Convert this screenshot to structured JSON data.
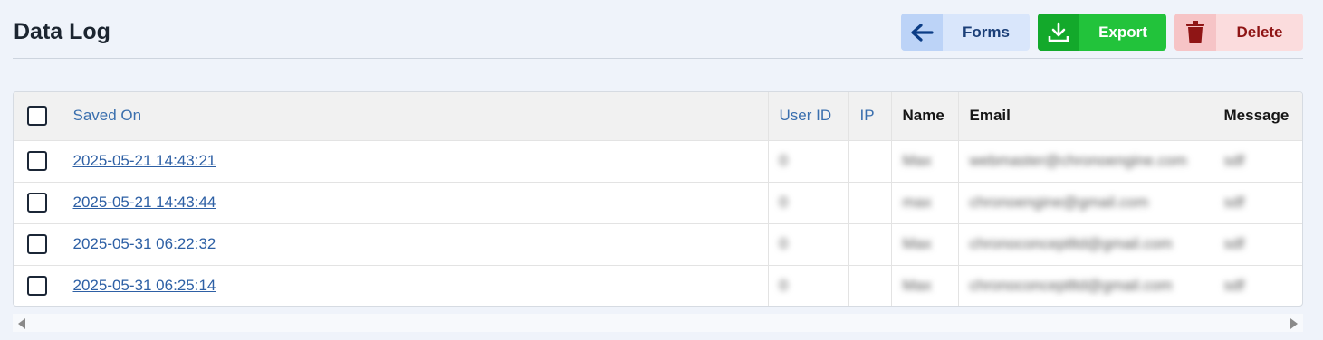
{
  "page": {
    "title": "Data Log"
  },
  "toolbar": {
    "forms_label": "Forms",
    "export_label": "Export",
    "delete_label": "Delete"
  },
  "table": {
    "columns": [
      "Saved On",
      "User ID",
      "IP",
      "Name",
      "Email",
      "Message"
    ],
    "rows": [
      {
        "saved_on": "2025-05-21 14:43:21",
        "user_id": "0",
        "ip": "",
        "name": "Max",
        "email": "webmaster@chronoengine.com",
        "message": "sdf"
      },
      {
        "saved_on": "2025-05-21 14:43:44",
        "user_id": "0",
        "ip": "",
        "name": "max",
        "email": "chronoengine@gmail.com",
        "message": "sdf"
      },
      {
        "saved_on": "2025-05-31 06:22:32",
        "user_id": "0",
        "ip": "",
        "name": "Max",
        "email": "chronoconceptltd@gmail.com",
        "message": "sdf"
      },
      {
        "saved_on": "2025-05-31 06:25:14",
        "user_id": "0",
        "ip": "",
        "name": "Max",
        "email": "chronoconceptltd@gmail.com",
        "message": "sdf"
      }
    ]
  },
  "colors": {
    "forms_bg": "#d9e6fb",
    "export_bg": "#22c33b",
    "delete_bg": "#fbdcdd",
    "link": "#2e60a5"
  },
  "icons": {
    "forms": "arrow-left-icon",
    "export": "download-icon",
    "delete": "trash-icon"
  }
}
